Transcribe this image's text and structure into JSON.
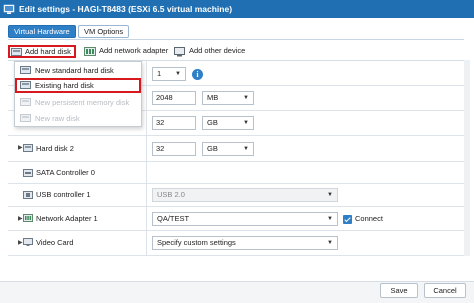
{
  "window": {
    "title": "Edit settings - HAGI-T8483 (ESXi 6.5 virtual machine)"
  },
  "tabs": [
    {
      "label": "Virtual Hardware",
      "active": true
    },
    {
      "label": "VM Options",
      "active": false
    }
  ],
  "toolbar": {
    "add_hard_disk": "Add hard disk",
    "add_network_adapter": "Add network adapter",
    "add_other_device": "Add other device"
  },
  "add_disk_menu": [
    {
      "label": "New standard hard disk",
      "enabled": true,
      "icon": "hard-disk-icon"
    },
    {
      "label": "Existing hard disk",
      "enabled": true,
      "icon": "hard-disk-icon"
    },
    {
      "label": "New persistent memory disk",
      "enabled": false,
      "icon": "memory-disk-icon"
    },
    {
      "label": "New raw disk",
      "enabled": false,
      "icon": "raw-disk-icon"
    }
  ],
  "hardware": {
    "cpu_value": "1",
    "memory_value": "2048",
    "memory_unit": "MB",
    "hard_disk_1_size": "32",
    "hard_disk_1_unit": "GB",
    "hard_disk_2_label": "Hard disk 2",
    "hard_disk_2_size": "32",
    "hard_disk_2_unit": "GB",
    "sata_label": "SATA Controller 0",
    "usb_label": "USB controller 1",
    "usb_value": "USB 2.0",
    "network_label": "Network Adapter 1",
    "network_value": "QA/TEST",
    "connect_label": "Connect",
    "connect_checked": true,
    "video_label": "Video Card",
    "video_value": "Specify custom settings"
  },
  "footer": {
    "save_label": "Save",
    "cancel_label": "Cancel"
  },
  "colors": {
    "titlebar": "#1f6fb2",
    "tab_active": "#2f7fc6",
    "highlight_border": "#d8181f"
  }
}
